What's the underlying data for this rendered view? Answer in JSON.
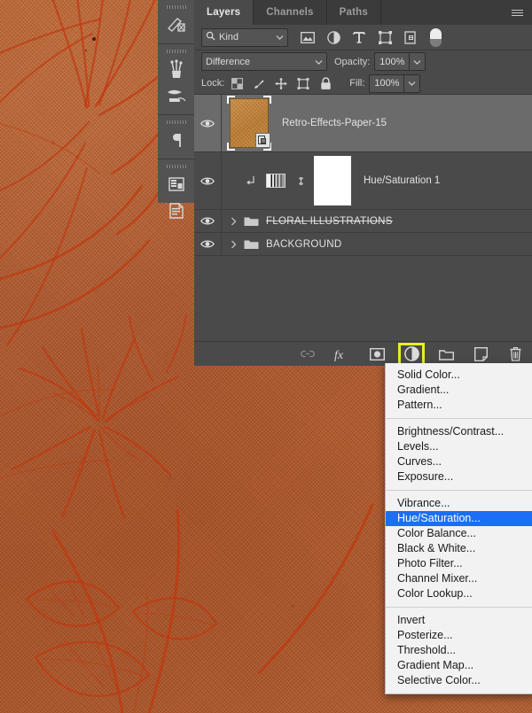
{
  "panel": {
    "tabs": [
      {
        "label": "Layers",
        "active": true
      },
      {
        "label": "Channels",
        "active": false
      },
      {
        "label": "Paths",
        "active": false
      }
    ],
    "menu_button_icon": "hamburger-menu-icon",
    "filter": {
      "kind_label": "Kind",
      "search_icon": "search-icon",
      "chevron_icon": "chevron-down-icon",
      "icons": [
        "pixel-layer-filter-icon",
        "adjustment-layer-filter-icon",
        "type-layer-filter-icon",
        "shape-layer-filter-icon",
        "smart-object-filter-icon"
      ],
      "toggle_icon": "filter-enable-toggle"
    },
    "blend": {
      "mode": "Difference",
      "opacity_label": "Opacity:",
      "opacity_value": "100%"
    },
    "lock": {
      "label": "Lock:",
      "icons": [
        "lock-transparent-pixels-icon",
        "lock-image-pixels-icon",
        "lock-position-icon",
        "lock-artboard-nesting-icon",
        "lock-all-icon"
      ],
      "fill_label": "Fill:",
      "fill_value": "100%"
    },
    "layers": [
      {
        "name": "Retro-Effects-Paper-15",
        "type": "smart-object",
        "selected": true,
        "visible": true,
        "visibility_icon": "eye-icon",
        "badge_icon": "smart-object-badge-icon"
      },
      {
        "name": "Hue/Saturation 1",
        "type": "adjustment",
        "selected": false,
        "visible": true,
        "visibility_icon": "eye-icon",
        "clipping_icon": "clipping-mask-arrow-icon",
        "adjustment_icon": "hue-saturation-icon",
        "link_icon": "link-mask-icon",
        "mask_color": "#ffffff"
      },
      {
        "name": "FLORAL ILLUSTRATIONS",
        "type": "group",
        "selected": false,
        "visible": true,
        "struck": true,
        "visibility_icon": "eye-icon",
        "disclosure_icon": "chevron-right-icon",
        "folder_icon": "folder-icon"
      },
      {
        "name": "BACKGROUND",
        "type": "group",
        "selected": false,
        "visible": true,
        "struck": false,
        "visibility_icon": "eye-icon",
        "disclosure_icon": "chevron-right-icon",
        "folder_icon": "folder-icon"
      }
    ],
    "footer_buttons": [
      {
        "name": "link-layers-button",
        "icon": "link-icon",
        "highlighted": false
      },
      {
        "name": "layer-style-button",
        "icon": "fx-icon",
        "highlighted": false
      },
      {
        "name": "add-layer-mask-button",
        "icon": "layer-mask-icon",
        "highlighted": false
      },
      {
        "name": "new-adjustment-layer-button",
        "icon": "half-filled-circle-icon",
        "highlighted": true
      },
      {
        "name": "new-group-button",
        "icon": "folder-icon",
        "highlighted": false
      },
      {
        "name": "new-layer-button",
        "icon": "new-layer-icon",
        "highlighted": false
      },
      {
        "name": "delete-layer-button",
        "icon": "trash-icon",
        "highlighted": false
      }
    ],
    "highlight_color": "#e9ef20"
  },
  "dock": {
    "groups": [
      {
        "items": [
          {
            "icon": "adjustments-panel-icon"
          }
        ]
      },
      {
        "items": [
          {
            "icon": "brushes-panel-icon"
          },
          {
            "icon": "brush-presets-panel-icon"
          }
        ]
      },
      {
        "items": [
          {
            "icon": "paragraph-panel-icon"
          }
        ]
      },
      {
        "items": [
          {
            "icon": "character-styles-panel-icon"
          },
          {
            "icon": "paragraph-styles-panel-icon"
          }
        ]
      }
    ]
  },
  "context_menu": {
    "sections": [
      {
        "items": [
          {
            "label": "Solid Color...",
            "active": false
          },
          {
            "label": "Gradient...",
            "active": false
          },
          {
            "label": "Pattern...",
            "active": false
          }
        ]
      },
      {
        "items": [
          {
            "label": "Brightness/Contrast...",
            "active": false
          },
          {
            "label": "Levels...",
            "active": false
          },
          {
            "label": "Curves...",
            "active": false
          },
          {
            "label": "Exposure...",
            "active": false
          }
        ]
      },
      {
        "items": [
          {
            "label": "Vibrance...",
            "active": false
          },
          {
            "label": "Hue/Saturation...",
            "active": true
          },
          {
            "label": "Color Balance...",
            "active": false
          },
          {
            "label": "Black & White...",
            "active": false
          },
          {
            "label": "Photo Filter...",
            "active": false
          },
          {
            "label": "Channel Mixer...",
            "active": false
          },
          {
            "label": "Color Lookup...",
            "active": false
          }
        ]
      },
      {
        "items": [
          {
            "label": "Invert",
            "active": false
          },
          {
            "label": "Posterize...",
            "active": false
          },
          {
            "label": "Threshold...",
            "active": false
          },
          {
            "label": "Gradient Map...",
            "active": false
          },
          {
            "label": "Selective Color...",
            "active": false
          }
        ]
      }
    ],
    "highlight_color": "#1b6ef5"
  },
  "canvas": {
    "description": "Textured rust-orange paper with red floral line illustrations",
    "base_color": "#b5653a",
    "line_color": "#c03a16"
  }
}
